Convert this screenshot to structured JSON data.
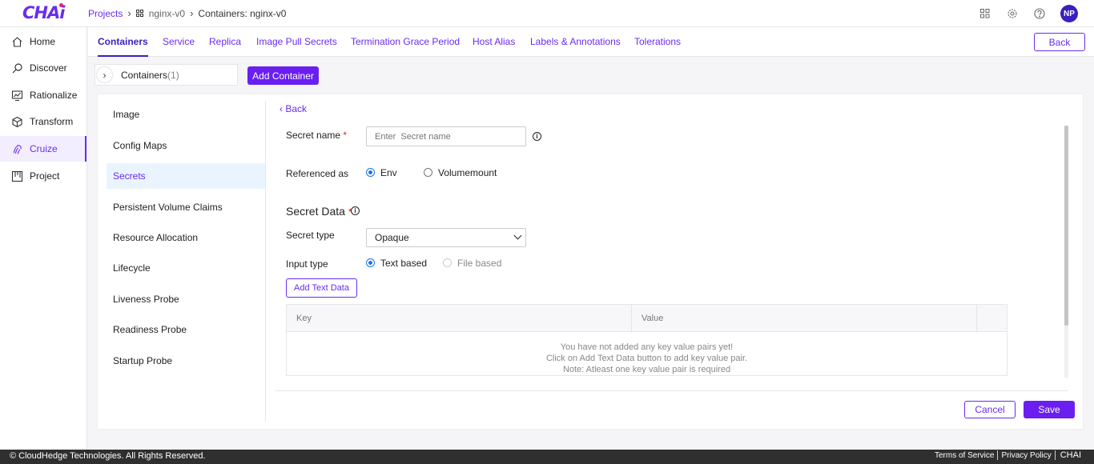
{
  "brand": {
    "logo": "CHAi",
    "accent": "#6a1ff0"
  },
  "breadcrumb": {
    "projects": "Projects",
    "project": "nginx-v0",
    "current": "Containers: nginx-v0"
  },
  "user": {
    "initials": "NP"
  },
  "sidebar": {
    "items": [
      {
        "label": "Home",
        "icon": "home-icon"
      },
      {
        "label": "Discover",
        "icon": "search-icon"
      },
      {
        "label": "Rationalize",
        "icon": "chart-icon"
      },
      {
        "label": "Transform",
        "icon": "cube-icon"
      },
      {
        "label": "Cruize",
        "icon": "fingerprint-icon",
        "active": true
      },
      {
        "label": "Project",
        "icon": "board-icon"
      }
    ]
  },
  "tabs": [
    "Containers",
    "Service",
    "Replica",
    "Image Pull Secrets",
    "Termination Grace Period",
    "Host Alias",
    "Labels & Annotations",
    "Tolerations"
  ],
  "back_label": "Back",
  "containers": {
    "label": "Containers",
    "count": "(1)",
    "add_label": "Add Container"
  },
  "menu": [
    "Image",
    "Config Maps",
    "Secrets",
    "Persistent Volume Claims",
    "Resource Allocation",
    "Lifecycle",
    "Liveness Probe",
    "Readiness Probe",
    "Startup Probe"
  ],
  "form": {
    "back": "Back",
    "secret_name_label": "Secret name",
    "secret_name_placeholder": "Enter  Secret name",
    "required_mark": "*",
    "info_mark": "i",
    "referenced_as_label": "Referenced as",
    "ref_options": [
      "Env",
      "Volumemount"
    ],
    "secret_data_heading": "Secret Data",
    "secret_type_label": "Secret type",
    "secret_type_value": "Opaque",
    "input_type_label": "Input type",
    "input_options": [
      "Text based",
      "File based"
    ],
    "add_text_label": "Add Text Data",
    "table": {
      "columns": [
        "Key",
        "Value"
      ],
      "empty": [
        "You have not added any key value pairs yet!",
        "Click on Add Text Data button to add key value pair.",
        "Note: Atleast one key value pair is required"
      ]
    },
    "cancel": "Cancel",
    "save": "Save"
  },
  "footer": {
    "copyright": "© CloudHedge Technologies. All Rights Reserved.",
    "terms": "Terms of Service",
    "privacy": "Privacy Policy",
    "brand": "CHAI"
  }
}
